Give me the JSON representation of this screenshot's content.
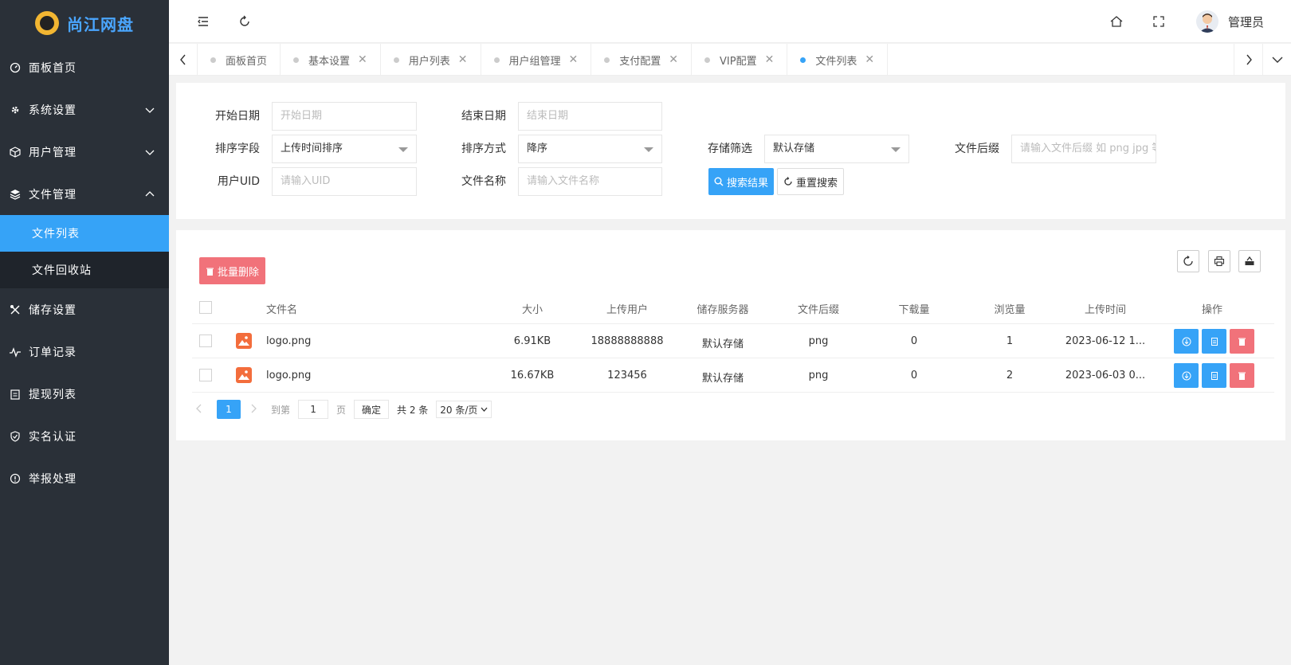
{
  "app": {
    "title": "尚江网盘",
    "brand_color": "#4aa6ff",
    "accent": "#36a3f7",
    "danger": "#f1727a"
  },
  "sidebar": {
    "items": [
      {
        "label": "面板首页",
        "icon": "dashboard-icon"
      },
      {
        "label": "系统设置",
        "icon": "gear-icon",
        "expandable": true
      },
      {
        "label": "用户管理",
        "icon": "cube-icon",
        "expandable": true
      },
      {
        "label": "文件管理",
        "icon": "layers-icon",
        "expanded": true
      },
      {
        "label": "储存设置",
        "icon": "tools-icon"
      },
      {
        "label": "订单记录",
        "icon": "pulse-icon"
      },
      {
        "label": "提现列表",
        "icon": "clipboard-icon"
      },
      {
        "label": "实名认证",
        "icon": "shield-icon"
      },
      {
        "label": "举报处理",
        "icon": "alert-icon"
      }
    ],
    "sub_items": [
      {
        "label": "文件列表",
        "active": true
      },
      {
        "label": "文件回收站"
      }
    ]
  },
  "header": {
    "user_name": "管理员"
  },
  "tabs": [
    {
      "label": "面板首页"
    },
    {
      "label": "基本设置"
    },
    {
      "label": "用户列表"
    },
    {
      "label": "用户组管理"
    },
    {
      "label": "支付配置"
    },
    {
      "label": "VIP配置"
    },
    {
      "label": "文件列表",
      "active": true
    }
  ],
  "filters": {
    "start_date": {
      "label": "开始日期",
      "placeholder": "开始日期"
    },
    "end_date": {
      "label": "结束日期",
      "placeholder": "结束日期"
    },
    "sort_field": {
      "label": "排序字段",
      "value": "上传时间排序"
    },
    "sort_order": {
      "label": "排序方式",
      "value": "降序"
    },
    "storage": {
      "label": "存储筛选",
      "value": "默认存储"
    },
    "suffix": {
      "label": "文件后缀",
      "placeholder": "请输入文件后缀 如 png jpg 等"
    },
    "uid": {
      "label": "用户UID",
      "placeholder": "请输入UID"
    },
    "filename": {
      "label": "文件名称",
      "placeholder": "请输入文件名称"
    },
    "search_btn": "搜索结果",
    "reset_btn": "重置搜索"
  },
  "table": {
    "batch_delete": "批量删除",
    "columns": [
      "文件名",
      "大小",
      "上传用户",
      "储存服务器",
      "文件后缀",
      "下载量",
      "浏览量",
      "上传时间",
      "操作"
    ],
    "rows": [
      {
        "name": "logo.png",
        "size": "6.91KB",
        "user": "18888888888",
        "server": "默认存储",
        "ext": "png",
        "downloads": "0",
        "views": "1",
        "time": "2023-06-12 1..."
      },
      {
        "name": "logo.png",
        "size": "16.67KB",
        "user": "123456",
        "server": "默认存储",
        "ext": "png",
        "downloads": "0",
        "views": "2",
        "time": "2023-06-03 0..."
      }
    ]
  },
  "pagination": {
    "current": "1",
    "goto_label": "到第",
    "goto_value": "1",
    "page_unit": "页",
    "confirm": "确定",
    "total": "共 2 条",
    "page_size": "20 条/页"
  }
}
